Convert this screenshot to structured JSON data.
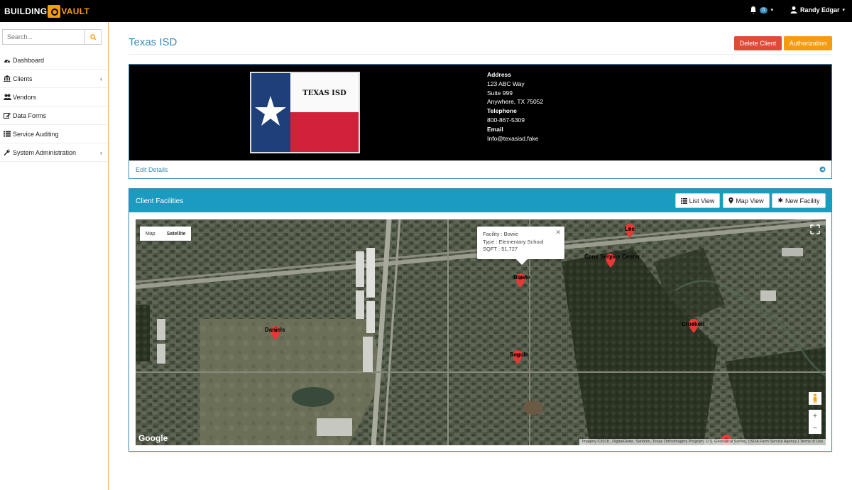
{
  "brand": {
    "part1": "BUILDING",
    "part2": "VAULT"
  },
  "navbar": {
    "notif_count": "0",
    "user_name": "Randy Edgar"
  },
  "sidebar": {
    "search_placeholder": "Search...",
    "items": [
      {
        "label": "Dashboard",
        "icon": "dashboard-icon",
        "has_children": false
      },
      {
        "label": "Clients",
        "icon": "bank-icon",
        "has_children": true
      },
      {
        "label": "Vendors",
        "icon": "users-icon",
        "has_children": false
      },
      {
        "label": "Data Forms",
        "icon": "edit-icon",
        "has_children": false
      },
      {
        "label": "Service Auditing",
        "icon": "list-icon",
        "has_children": false
      },
      {
        "label": "System Administration",
        "icon": "wrench-icon",
        "has_children": true
      }
    ]
  },
  "page": {
    "title": "Texas ISD",
    "delete_label": "Delete Client",
    "auth_label": "Authorization"
  },
  "client": {
    "flag_text": "TEXAS ISD",
    "address_label": "Address",
    "address_lines": [
      "123 ABC Way",
      "Suite 999",
      "Anywhere, TX 75052"
    ],
    "telephone_label": "Telephone",
    "telephone": "800-867-5309",
    "email_label": "Email",
    "email": "Info@texasisd.fake",
    "edit_label": "Edit Details"
  },
  "facilities": {
    "title": "Client Facilities",
    "list_view_label": "List View",
    "map_view_label": "Map View",
    "new_facility_label": "New Facility",
    "map_type": {
      "map": "Map",
      "satellite": "Satellite"
    },
    "markers": [
      {
        "label": "Lee"
      },
      {
        "label": "Cons Service Center"
      },
      {
        "label": "Bowie"
      },
      {
        "label": "Crockett"
      },
      {
        "label": "Daniels"
      },
      {
        "label": "Seguin"
      },
      {
        "label": ""
      }
    ],
    "infowindow": {
      "facility": "Facility : Bowie",
      "type": "Type : Elementary School",
      "sqft": "SQFT : 51,727"
    },
    "google_label": "Google",
    "attribution": "Imagery ©2018 , DigitalGlobe, Sanborn, Texas Orthoimagery Program, U.S. Geological Survey, USDA Farm Service Agency | Terms of Use"
  },
  "colors": {
    "brand_orange": "#f39c12",
    "primary": "#3c8dbc",
    "danger": "#dd4b39",
    "panel_head": "#1a9bbf"
  }
}
